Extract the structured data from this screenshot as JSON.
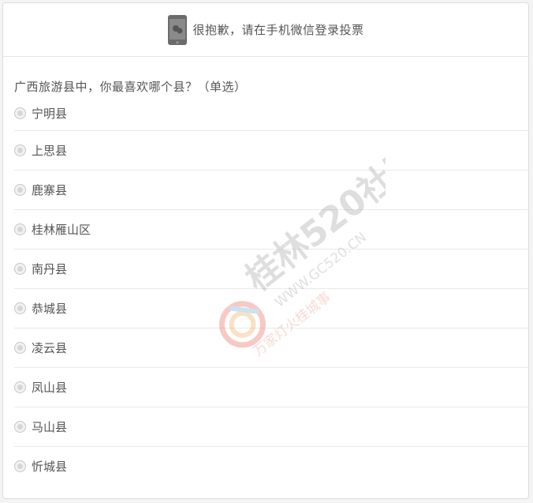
{
  "notice": {
    "icon": "wechat-phone-icon",
    "text": "很抱歉，请在手机微信登录投票"
  },
  "question": {
    "text": "广西旅游县中，你最喜欢哪个县？（单选）"
  },
  "options": [
    {
      "label": "宁明县"
    },
    {
      "label": "上思县"
    },
    {
      "label": "鹿寨县"
    },
    {
      "label": "桂林雁山区"
    },
    {
      "label": "南丹县"
    },
    {
      "label": "恭城县"
    },
    {
      "label": "凌云县"
    },
    {
      "label": "凤山县"
    },
    {
      "label": "马山县"
    },
    {
      "label": "忻城县"
    }
  ],
  "watermark": {
    "brand": "桂林520社区",
    "url": "WWW.GC520.CN",
    "slogan": "万家灯火桂城事"
  },
  "colors": {
    "text": "#555555",
    "divider": "#e9e9e9",
    "radio": "#d6d6d6",
    "phone": "#6b6b6b"
  }
}
